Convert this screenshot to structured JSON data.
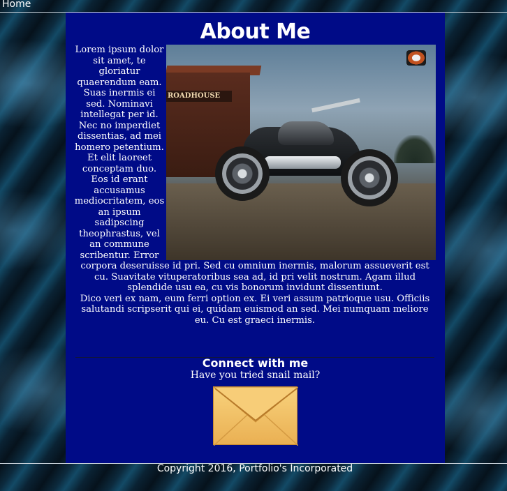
{
  "nav": {
    "home_label": "Home"
  },
  "page": {
    "title": "About Me"
  },
  "about": {
    "paragraph_1": "Lorem ipsum dolor sit amet, te gloriatur quaerendum eam. Suas inermis ei sed. Nominavi intellegat per id. Nec no imperdiet dissentias, ad mei homero petentium.",
    "paragraph_2": "Et elit laoreet conceptam duo. Eos id erant accusamus mediocritatem, eos an ipsum sadipscing theophrastus, vel an commune scribentur. Error corpora deseruisse id pri. Sed cu omnium inermis, malorum assueverit est cu. Suavitate vituperatoribus sea ad, id pri velit nostrum. Agam illud splendide usu ea, cu vis bonorum invidunt dissentiunt.",
    "paragraph_3": "Dico veri ex nam, eum ferri option ex. Ei veri assum patrioque usu. Officiis salutandi scripserit qui ei, quidam euismod an sed. Mei numquam meliore eu. Cu est graeci inermis.",
    "photo_sign_text": "ROADHOUSE"
  },
  "connect": {
    "title": "Connect with me",
    "subtitle": "Have you tried snail mail?",
    "envelope_icon": "envelope-icon"
  },
  "footer": {
    "copyright": "Copyright 2016, Portfolio's Incorporated"
  },
  "colors": {
    "panel_background": "#000b87",
    "envelope": "#f2c066"
  }
}
